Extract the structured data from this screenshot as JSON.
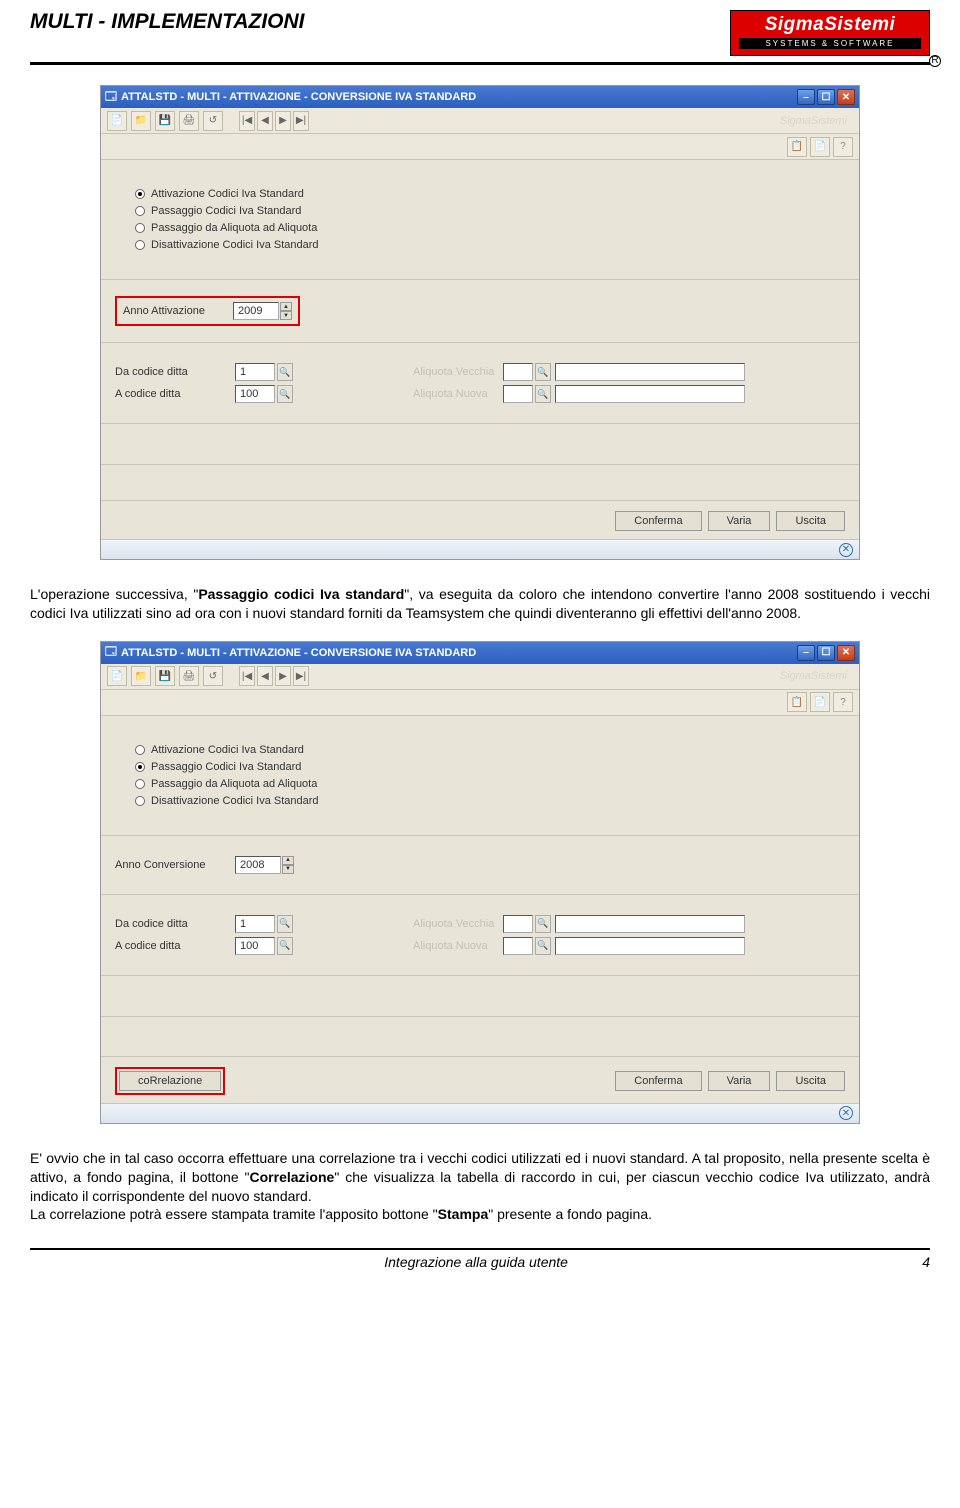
{
  "doc": {
    "title": "MULTI - IMPLEMENTAZIONI",
    "logo_main": "SigmaSistemi",
    "logo_sub": "SYSTEMS & SOFTWARE",
    "logo_reg": "R"
  },
  "para1": "L'operazione successiva, \"Passaggio codici Iva standard\", va eseguita da coloro che intendono convertire l'anno 2008 sostituendo i vecchi codici Iva utilizzati sino ad ora con i nuovi standard forniti da Teamsystem che quindi diventeranno gli effettivi dell'anno 2008.",
  "para1_bold": "Passaggio codici Iva standard",
  "para2": "E' ovvio che in tal caso occorra effettuare una correlazione tra i vecchi codici utilizzati ed i nuovi standard. A tal proposito, nella presente scelta è attivo, a fondo pagina, il bottone \"Correlazione\" che visualizza la tabella di raccordo in cui, per ciascun vecchio codice Iva utilizzato, andrà indicato il corrispondente del nuovo standard.",
  "para2_bold": "Correlazione",
  "para3": "La correlazione potrà essere stampata tramite l'apposito bottone \"Stampa\" presente a fondo pagina.",
  "para3_bold": "Stampa",
  "footer": {
    "center": "Integrazione alla guida utente",
    "page": "4"
  },
  "app": {
    "title": "ATTALSTD - MULTI - ATTIVAZIONE - CONVERSIONE IVA STANDARD",
    "brand_watermark": "SigmaSistemi",
    "radios": {
      "r1": "Attivazione Codici Iva Standard",
      "r2": "Passaggio Codici Iva Standard",
      "r3": "Passaggio da Aliquota ad Aliquota",
      "r4": "Disattivazione Codici Iva Standard"
    },
    "labels": {
      "anno_attivazione": "Anno Attivazione",
      "anno_conversione": "Anno Conversione",
      "da_codice": "Da codice ditta",
      "a_codice": "A   codice ditta",
      "aliq_vecchia": "Aliquota Vecchia",
      "aliq_nuova": "Aliquota Nuova"
    },
    "values": {
      "anno_1": "2009",
      "anno_2": "2008",
      "da_codice": "1",
      "a_codice": "100"
    },
    "buttons": {
      "conferma": "Conferma",
      "varia": "Varia",
      "uscita": "Uscita",
      "correlazione": "coRrelazione"
    }
  }
}
